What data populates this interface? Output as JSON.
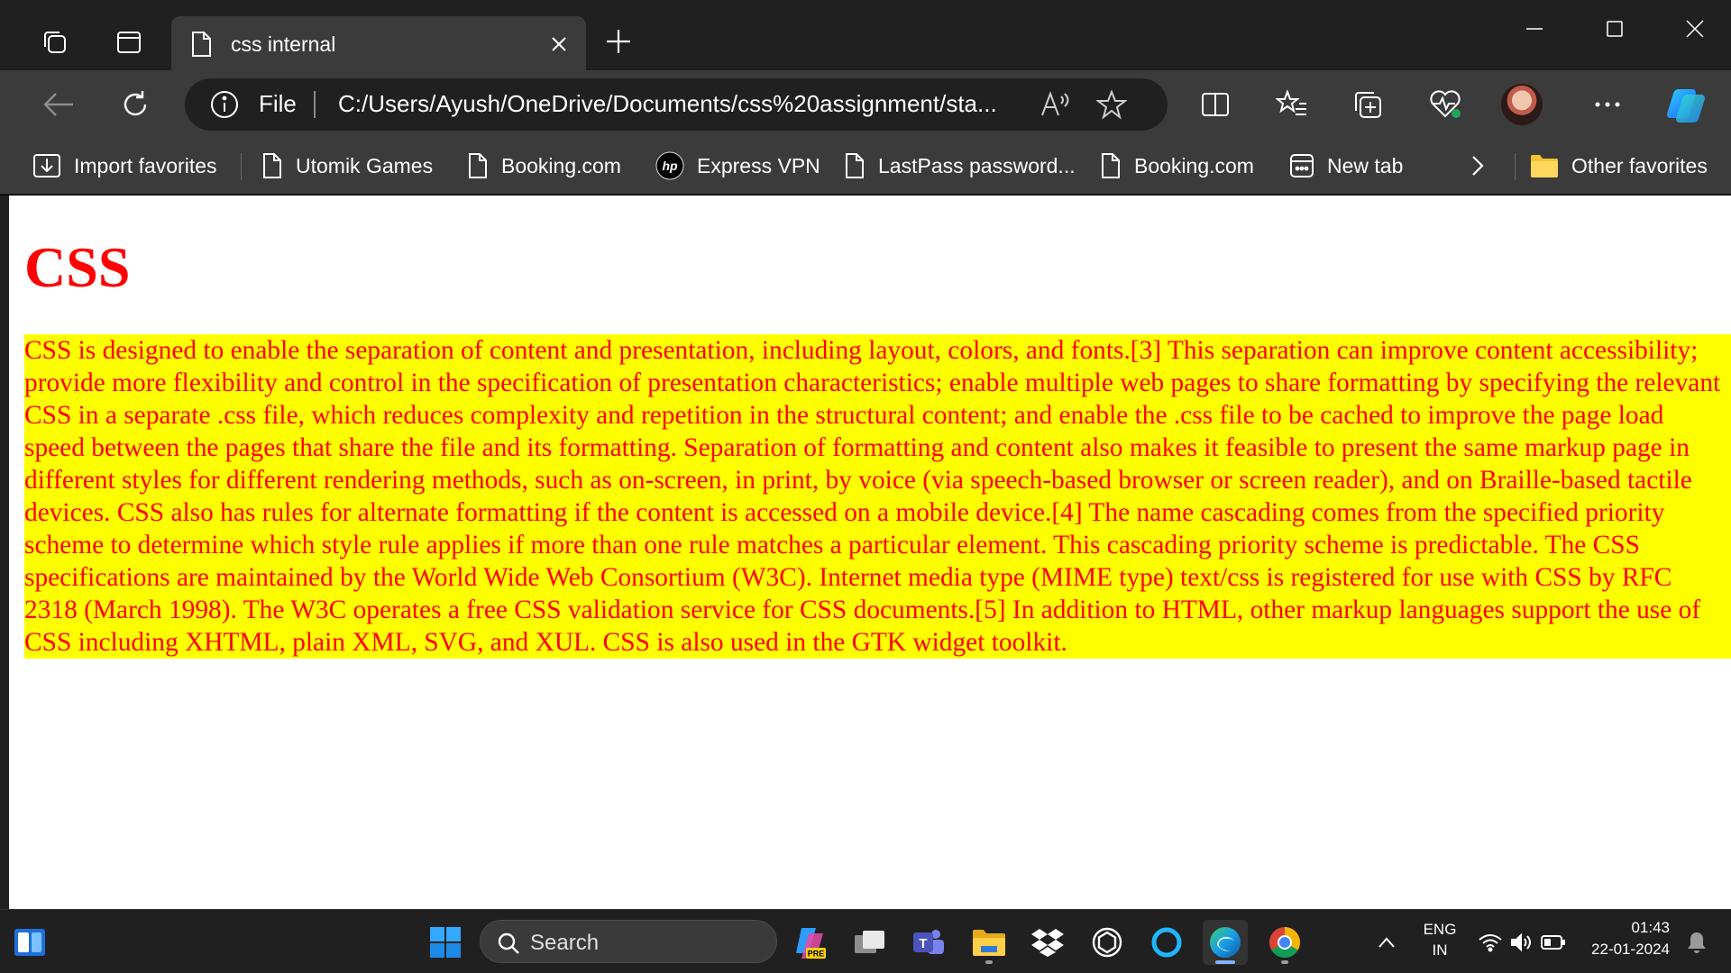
{
  "tab": {
    "title": "css internal"
  },
  "window_controls": {
    "minimize": "minimize",
    "maximize": "maximize",
    "close": "close"
  },
  "toolbar": {
    "omnibox_scheme_label": "File",
    "url": "C:/Users/Ayush/OneDrive/Documents/css%20assignment/sta..."
  },
  "favorites": [
    {
      "label": "Import favorites",
      "icon": "import-icon"
    },
    {
      "label": "Utomik Games",
      "icon": "page-icon"
    },
    {
      "label": "Booking.com",
      "icon": "page-icon"
    },
    {
      "label": "Express VPN",
      "icon": "hp-icon"
    },
    {
      "label": "LastPass password...",
      "icon": "page-icon"
    },
    {
      "label": "Booking.com",
      "icon": "page-icon"
    },
    {
      "label": "New tab",
      "icon": "newtab-icon"
    },
    {
      "label": "Other favorites",
      "icon": "folder-icon"
    }
  ],
  "page": {
    "heading": "CSS",
    "paragraph": "CSS is designed to enable the separation of content and presentation, including layout, colors, and fonts.[3] This separation can improve content accessibility; provide more flexibility and control in the specification of presentation characteristics; enable multiple web pages to share formatting by specifying the relevant CSS in a separate .css file, which reduces complexity and repetition in the structural content; and enable the .css file to be cached to improve the page load speed between the pages that share the file and its formatting. Separation of formatting and content also makes it feasible to present the same markup page in different styles for different rendering methods, such as on-screen, in print, by voice (via speech-based browser or screen reader), and on Braille-based tactile devices. CSS also has rules for alternate formatting if the content is accessed on a mobile device.[4] The name cascading comes from the specified priority scheme to determine which style rule applies if more than one rule matches a particular element. This cascading priority scheme is predictable. The CSS specifications are maintained by the World Wide Web Consortium (W3C). Internet media type (MIME type) text/css is registered for use with CSS by RFC 2318 (March 1998). The W3C operates a free CSS validation service for CSS documents.[5] In addition to HTML, other markup languages support the use of CSS including XHTML, plain XML, SVG, and XUL. CSS is also used in the GTK widget toolkit.",
    "heading_color": "#ff0000",
    "paragraph_color": "#ff0000",
    "paragraph_background": "#ffff00"
  },
  "taskbar": {
    "search_label": "Search",
    "language_line1": "ENG",
    "language_line2": "IN",
    "time": "01:43",
    "date": "22-01-2024",
    "copilot_badge": "PRE"
  }
}
